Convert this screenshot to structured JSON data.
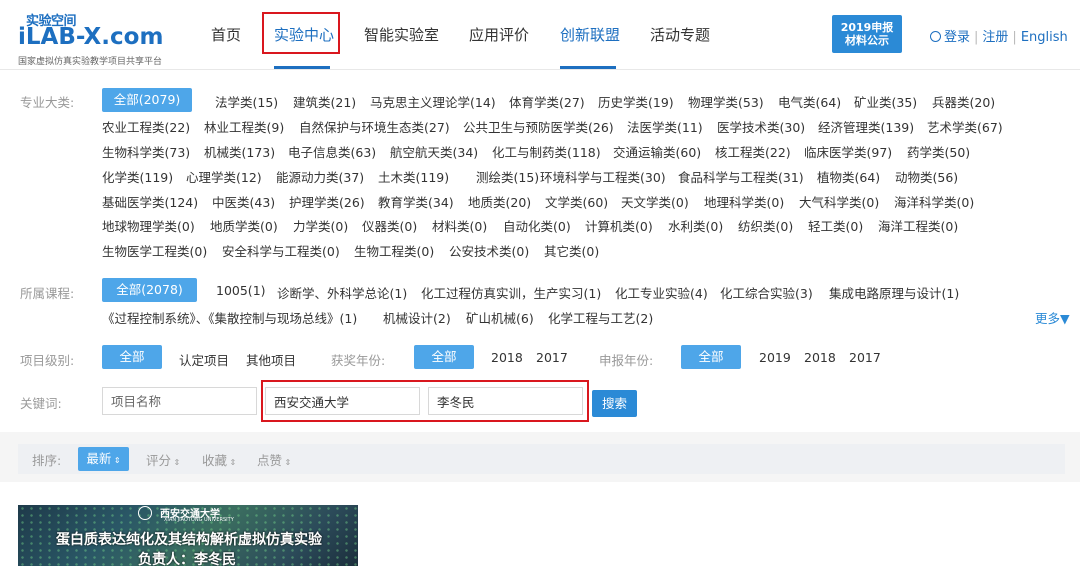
{
  "logo": {
    "top": "实验空间",
    "main": "iLAB-X.com",
    "sub": "国家虚拟仿真实验教学项目共享平台"
  },
  "nav": {
    "items": [
      {
        "label": "首页"
      },
      {
        "label": "实验中心"
      },
      {
        "label": "智能实验室"
      },
      {
        "label": "应用评价"
      },
      {
        "label": "创新联盟"
      },
      {
        "label": "活动专题"
      }
    ]
  },
  "badge": {
    "line1": "2019申报",
    "line2": "材料公示"
  },
  "user": {
    "login": "登录",
    "register": "注册",
    "language": "English"
  },
  "filters": {
    "major": {
      "label": "专业大类:",
      "all": "全部(2079)",
      "items": [
        "法学类(15)",
        "建筑类(21)",
        "马克思主义理论学(14)",
        "体育学类(27)",
        "历史学类(19)",
        "物理学类(53)",
        "电气类(64)",
        "矿业类(35)",
        "兵器类(20)",
        "农业工程类(22)",
        "林业工程类(9)",
        "自然保护与环境生态类(27)",
        "公共卫生与预防医学类(26)",
        "法医学类(11)",
        "医学技术类(30)",
        "经济管理类(139)",
        "艺术学类(67)",
        "生物科学类(73)",
        "机械类(173)",
        "电子信息类(63)",
        "航空航天类(34)",
        "化工与制药类(118)",
        "交通运输类(60)",
        "核工程类(22)",
        "临床医学类(97)",
        "药学类(50)",
        "化学类(119)",
        "心理学类(12)",
        "能源动力类(37)",
        "土木类(119)",
        "测绘类(15)",
        "环境科学与工程类(30)",
        "食品科学与工程类(31)",
        "植物类(64)",
        "动物类(56)",
        "基础医学类(124)",
        "中医类(43)",
        "护理学类(26)",
        "教育学类(34)",
        "地质类(20)",
        "文学类(60)",
        "天文学类(0)",
        "地理科学类(0)",
        "大气科学类(0)",
        "海洋科学类(0)",
        "地球物理学类(0)",
        "地质学类(0)",
        "力学类(0)",
        "仪器类(0)",
        "材料类(0)",
        "自动化类(0)",
        "计算机类(0)",
        "水利类(0)",
        "纺织类(0)",
        "轻工类(0)",
        "海洋工程类(0)",
        "生物医学工程类(0)",
        "安全科学与工程类(0)",
        "生物工程类(0)",
        "公安技术类(0)",
        "其它类(0)"
      ]
    },
    "course": {
      "label": "所属课程:",
      "all": "全部(2078)",
      "items": [
        "1005(1)",
        "诊断学、外科学总论(1)",
        "化工过程仿真实训，生产实习(1)",
        "化工专业实验(4)",
        "化工综合实验(3)",
        "集成电路原理与设计(1)",
        "《过程控制系统》、《集散控制与现场总线》(1)",
        "机械设计(2)",
        "矿山机械(6)",
        "化学工程与工艺(2)"
      ],
      "more": "更多▼"
    },
    "level": {
      "label": "项目级别:",
      "all": "全部",
      "items": [
        "认定项目",
        "其他项目"
      ]
    },
    "award_year": {
      "label": "获奖年份:",
      "all": "全部",
      "items": [
        "2018",
        "2017"
      ]
    },
    "apply_year": {
      "label": "申报年份:",
      "all": "全部",
      "items": [
        "2019",
        "2018",
        "2017"
      ]
    },
    "keyword": {
      "label": "关键词:",
      "project_placeholder": "项目名称",
      "school_value": "西安交通大学",
      "person_value": "李冬民",
      "search": "搜索"
    }
  },
  "sort": {
    "label": "排序:",
    "items": [
      "最新",
      "评分",
      "收藏",
      "点赞"
    ]
  },
  "result": {
    "school": "西安交通大学",
    "school_en": "XIAN JIAOTONG UNIVERSITY",
    "title": "蛋白质表达纯化及其结构解析虚拟仿真实验",
    "person": "负责人：李冬民"
  }
}
